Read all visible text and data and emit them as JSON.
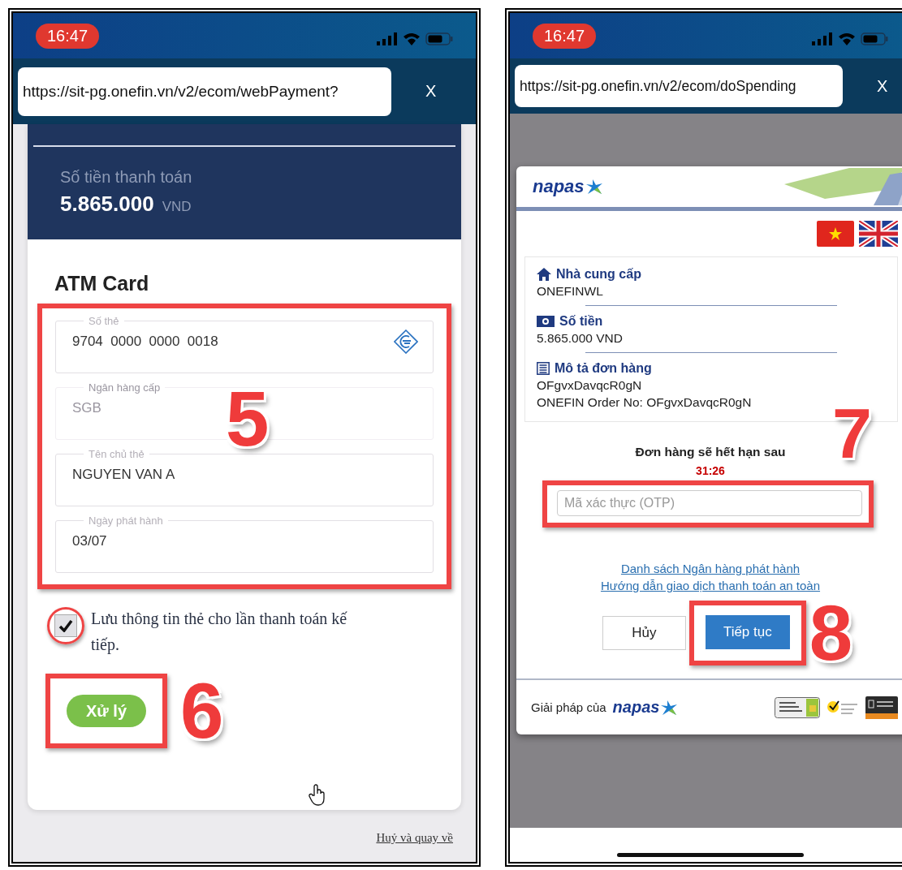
{
  "left_phone": {
    "status_bar": {
      "time": "16:47"
    },
    "url_bar": {
      "url": "https://sit-pg.onefin.vn/v2/ecom/webPayment?",
      "close_label": "X"
    },
    "amount_panel": {
      "label": "Số tiền thanh toán",
      "amount": "5.865.000",
      "currency": "VND"
    },
    "form": {
      "title": "ATM Card",
      "annotation": "5",
      "fields": [
        {
          "kind": "card_number",
          "label": "Số thẻ",
          "value": "9704  0000  0000  0018",
          "disabled": false
        },
        {
          "kind": "text",
          "label": "Ngân hàng cấp",
          "value": "SGB",
          "disabled": true
        },
        {
          "kind": "text",
          "label": "Tên chủ thẻ",
          "value": "NGUYEN VAN A",
          "disabled": false
        },
        {
          "kind": "text",
          "label": "Ngày phát hành",
          "value": "03/07",
          "disabled": false
        }
      ]
    },
    "save_card": {
      "label": "Lưu thông tin thẻ cho lần thanh toán kế tiếp.",
      "checked": true
    },
    "submit_button": {
      "label": "Xử lý",
      "annotation": "6"
    },
    "cancel_link": "Huỷ và quay về"
  },
  "right_phone": {
    "status_bar": {
      "time": "16:47"
    },
    "url_bar": {
      "url": "https://sit-pg.onefin.vn/v2/ecom/doSpending",
      "close_label": "X"
    },
    "dialog": {
      "logo": "napas",
      "info": [
        {
          "kind": "provider",
          "title": "Nhà cung cấp",
          "lines": [
            "ONEFINWL"
          ]
        },
        {
          "kind": "amount",
          "title": "Số tiền",
          "lines": [
            "5.865.000 VND"
          ]
        },
        {
          "kind": "description",
          "title": "Mô tả đơn hàng",
          "lines": [
            "OFgvxDavqcR0gN",
            "ONEFIN Order No: OFgvxDavqcR0gN"
          ]
        }
      ],
      "expiry": {
        "label": "Đơn hàng sẽ hết hạn sau",
        "countdown": "31:26"
      },
      "otp": {
        "placeholder": "Mã xác thực (OTP)",
        "annotation": "7"
      },
      "links": [
        "Danh sách Ngân hàng phát hành",
        "Hướng dẫn giao dịch thanh toán an toàn"
      ],
      "buttons": [
        {
          "kind": "secondary",
          "label": "Hủy"
        },
        {
          "kind": "primary",
          "label": "Tiếp tục",
          "annotation": "8"
        }
      ],
      "footer": {
        "label": "Giải pháp của",
        "logo": "napas"
      }
    }
  }
}
